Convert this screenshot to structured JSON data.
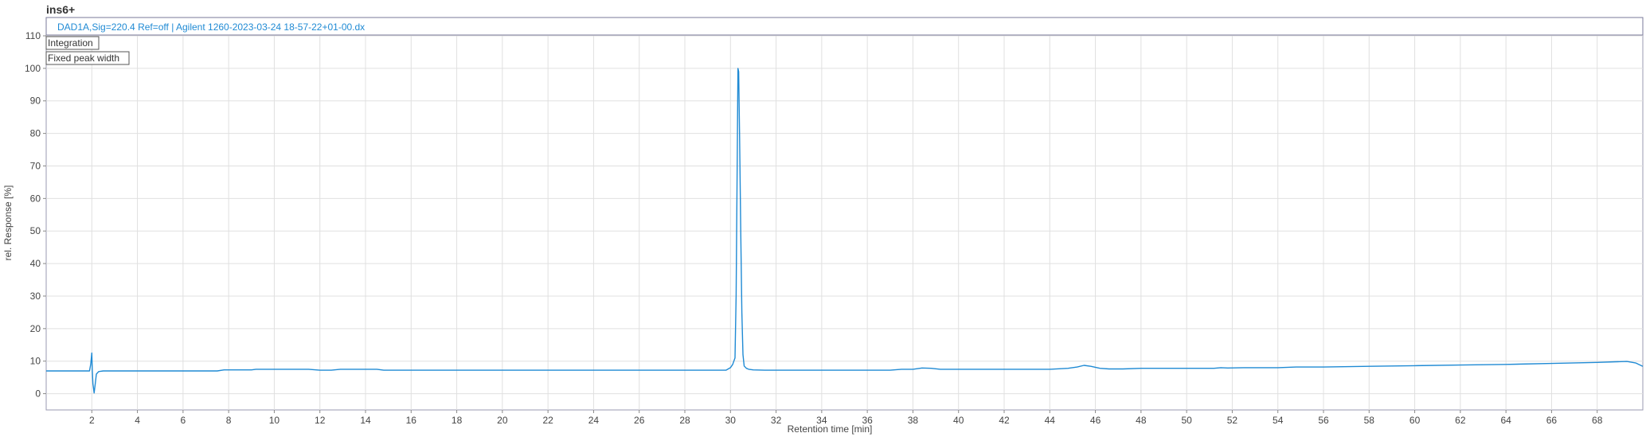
{
  "chart_data": {
    "type": "line",
    "title": "ins6+",
    "legend": "DAD1A,Sig=220.4  Ref=off | Agilent 1260-2023-03-24 18-57-22+01-00.dx",
    "xlabel": "Retention time [min]",
    "ylabel": "rel. Response [%]",
    "xlim": [
      0,
      70
    ],
    "ylim": [
      -5,
      110
    ],
    "xticks": [
      2,
      4,
      6,
      8,
      10,
      12,
      14,
      16,
      18,
      20,
      22,
      24,
      26,
      28,
      30,
      32,
      34,
      36,
      38,
      40,
      42,
      44,
      46,
      48,
      50,
      52,
      54,
      56,
      58,
      60,
      62,
      64,
      66,
      68
    ],
    "yticks": [
      0,
      10,
      20,
      30,
      40,
      50,
      60,
      70,
      80,
      90,
      100,
      110
    ],
    "grid": true,
    "series": [
      {
        "color": "#1f8ad4",
        "x": [
          0,
          1.9,
          1.95,
          2.0,
          2.02,
          2.05,
          2.1,
          2.15,
          2.2,
          2.3,
          2.5,
          3,
          5,
          7.5,
          7.8,
          8.1,
          9.0,
          9.2,
          11.5,
          12.0,
          12.5,
          12.9,
          14.5,
          14.8,
          16,
          20,
          24,
          28,
          29.8,
          30.0,
          30.1,
          30.2,
          30.25,
          30.3,
          30.33,
          30.36,
          30.4,
          30.45,
          30.5,
          30.55,
          30.6,
          30.7,
          30.8,
          31.0,
          31.5,
          33,
          36,
          37.0,
          37.5,
          38.0,
          38.4,
          38.8,
          39.2,
          40,
          42,
          44,
          44.8,
          45.2,
          45.5,
          45.8,
          46.2,
          46.6,
          47.2,
          48,
          50,
          51.2,
          51.5,
          51.8,
          52.5,
          54,
          54.8,
          55.2,
          56,
          58,
          60,
          62,
          64,
          66,
          68,
          68.8,
          69.3,
          69.7,
          70
        ],
        "y": [
          7,
          7,
          9,
          12.5,
          7,
          3,
          0.2,
          3,
          6,
          6.8,
          7,
          7,
          7,
          7,
          7.3,
          7.3,
          7.3,
          7.5,
          7.5,
          7.2,
          7.2,
          7.5,
          7.5,
          7.2,
          7.2,
          7.2,
          7.2,
          7.2,
          7.2,
          8,
          9,
          11,
          30,
          75,
          100,
          99,
          80,
          50,
          25,
          12,
          8.5,
          7.8,
          7.5,
          7.3,
          7.2,
          7.2,
          7.2,
          7.2,
          7.5,
          7.5,
          7.9,
          7.8,
          7.5,
          7.5,
          7.5,
          7.5,
          7.8,
          8.2,
          8.7,
          8.4,
          7.8,
          7.6,
          7.6,
          7.8,
          7.8,
          7.8,
          8.0,
          7.9,
          8.0,
          8.0,
          8.2,
          8.2,
          8.2,
          8.4,
          8.6,
          8.8,
          9.0,
          9.3,
          9.6,
          9.8,
          9.9,
          9.4,
          8.4
        ]
      }
    ]
  },
  "buttons": {
    "integration": "Integration",
    "fixed_peak_width": "Fixed peak width"
  }
}
